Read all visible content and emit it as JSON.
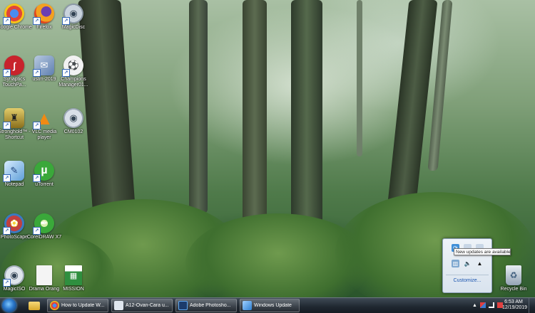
{
  "desktop": {
    "icons": [
      {
        "label": "Google Chrome",
        "icon": "chrome-icon",
        "glyph": "●",
        "color": "#e0463a"
      },
      {
        "label": "Firefox",
        "icon": "firefox-icon",
        "glyph": "●",
        "color": "#e8731e"
      },
      {
        "label": "MagicDisc",
        "icon": "disc-icon",
        "glyph": "◉",
        "color": "#9aa8b8"
      },
      {
        "label": "Synaptics TouchPa...",
        "icon": "synaptics-icon",
        "glyph": "ʃ",
        "color": "#c8232c"
      },
      {
        "label": "ustm-2019",
        "icon": "network-icon",
        "glyph": "✉",
        "color": "#6a8fc0"
      },
      {
        "label": "Champions Manager01...",
        "icon": "football-icon",
        "glyph": "⚽",
        "color": "#3f5f3f"
      },
      {
        "label": "Stronghold™ - Shortcut",
        "icon": "stronghold-icon",
        "glyph": "♜",
        "color": "#b39a3c"
      },
      {
        "label": "VLC media player",
        "icon": "vlc-icon",
        "glyph": "▲",
        "color": "#f08a14"
      },
      {
        "label": "CM0102",
        "icon": "cd-icon",
        "glyph": "◉",
        "color": "#b7c0cc"
      },
      {
        "label": "Notepad",
        "icon": "notepad-icon",
        "glyph": "✎",
        "color": "#5f9fd8"
      },
      {
        "label": "uTorrent",
        "icon": "utorrent-icon",
        "glyph": "µ",
        "color": "#3aa83a"
      },
      {
        "label": "PhotoScape",
        "icon": "photoscape-icon",
        "glyph": "✿",
        "color": "#c04040"
      },
      {
        "label": "CorelDRAW X7",
        "icon": "coreldraw-icon",
        "glyph": "✒",
        "color": "#3aa83a"
      },
      {
        "label": "MagicISO",
        "icon": "magiciso-icon",
        "glyph": "◉",
        "color": "#c9d0da"
      },
      {
        "label": "Drama Orang",
        "icon": "document-icon",
        "glyph": "▭",
        "color": "#e8e8e8"
      },
      {
        "label": "MISSION",
        "icon": "excel-icon",
        "glyph": "▦",
        "color": "#2f8f3f"
      },
      {
        "label": "Recycle Bin",
        "icon": "recycle-bin-icon",
        "glyph": "🗑",
        "color": "#a9b9c9"
      }
    ]
  },
  "taskbar": {
    "tasks": [
      {
        "label": "How to Update W...",
        "icon": "chrome-icon",
        "color": "#e0463a"
      },
      {
        "label": "A12-Ovan-Cara u...",
        "icon": "document-icon",
        "color": "#dfe6ee"
      },
      {
        "label": "Adobe Photosho...",
        "icon": "photoshop-icon",
        "color": "#1c3c6c"
      },
      {
        "label": "Windows Update",
        "icon": "windows-update-icon",
        "color": "#3f8fd8"
      }
    ],
    "clock": {
      "time": "6:53 AM",
      "date": "12/19/2019"
    }
  },
  "tray_popup": {
    "tooltip": "New updates are available",
    "customize_label": "Customize..."
  }
}
